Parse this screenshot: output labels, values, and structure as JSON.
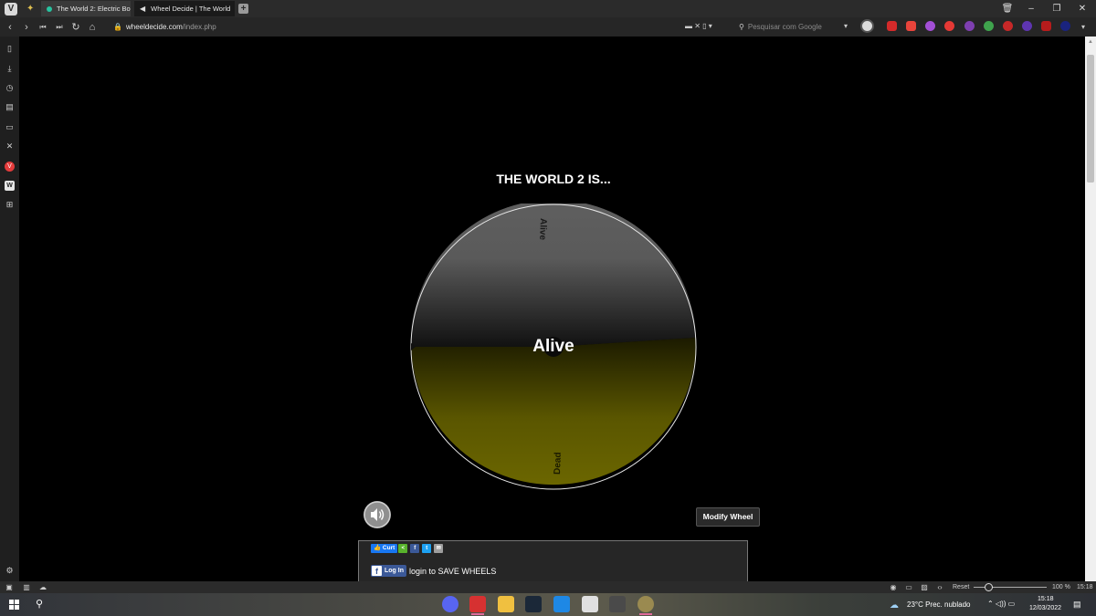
{
  "browser": {
    "tabs": [
      {
        "label": "The World 2: Electric Bo"
      },
      {
        "label": "Wheel Decide | The World"
      }
    ],
    "url_domain": "wheeldecide.com",
    "url_path": "/index.php",
    "search_placeholder": "Pesquisar com Google",
    "status": {
      "reset_label": "Reset",
      "zoom_label": "100 %",
      "zoom_level": 100,
      "clock": "15:18"
    }
  },
  "page": {
    "title": "THE WORLD 2 IS...",
    "wheel": {
      "segments": [
        {
          "label": "Alive",
          "color_top": "#5f5f5f",
          "color_bottom": "#111111"
        },
        {
          "label": "Dead",
          "color_top": "#1b1a00",
          "color_bottom": "#6b6600"
        }
      ],
      "result": "Alive"
    },
    "modify_button": "Modify Wheel",
    "share": {
      "like_label": "Curt",
      "login_button": "Log In",
      "login_text": "login to SAVE WHEELS"
    }
  },
  "taskbar": {
    "weather": "23°C  Prec. nublado",
    "time": "15:18",
    "date": "12/03/2022"
  }
}
